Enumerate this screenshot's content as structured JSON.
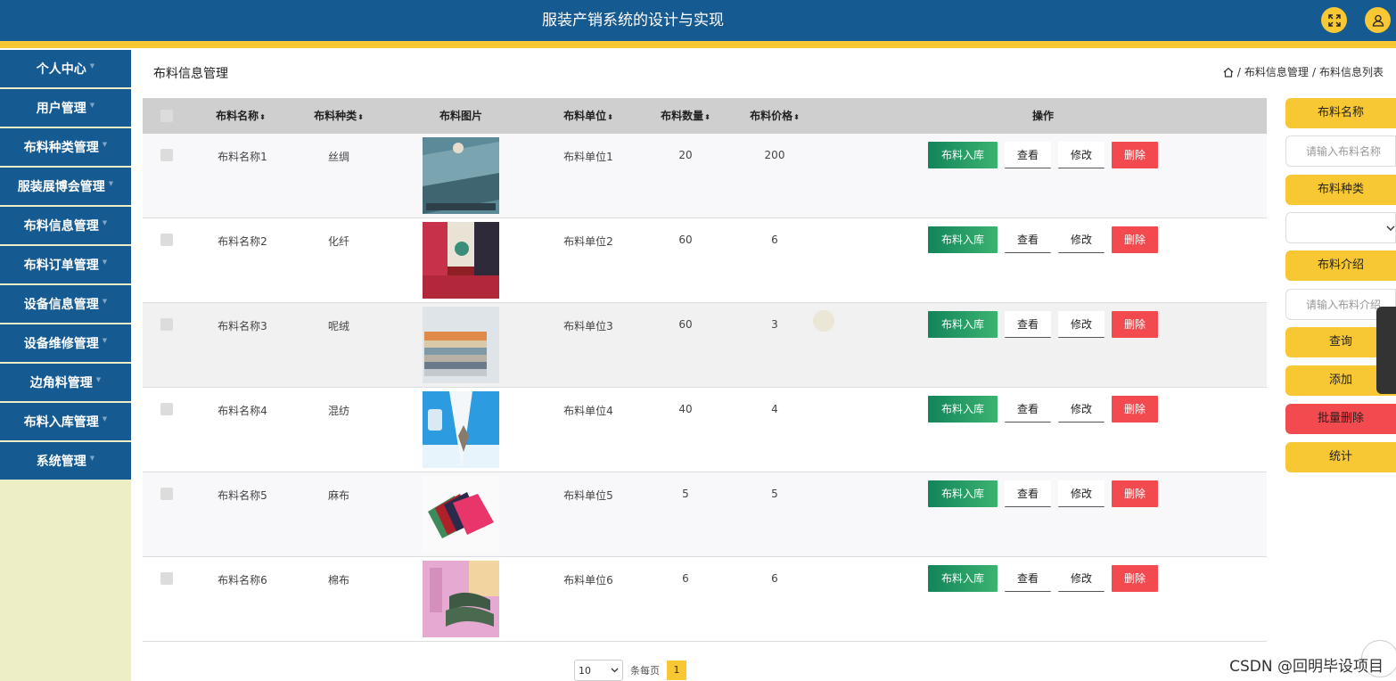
{
  "header": {
    "title": "服装产销系统的设计与实现"
  },
  "sidebar": {
    "items": [
      {
        "label": "个人中心"
      },
      {
        "label": "用户管理"
      },
      {
        "label": "布料种类管理"
      },
      {
        "label": "服装展博会管理"
      },
      {
        "label": "布料信息管理"
      },
      {
        "label": "布料订单管理"
      },
      {
        "label": "设备信息管理"
      },
      {
        "label": "设备维修管理"
      },
      {
        "label": "边角料管理"
      },
      {
        "label": "布料入库管理"
      },
      {
        "label": "系统管理"
      }
    ]
  },
  "page": {
    "title": "布料信息管理"
  },
  "breadcrumb": {
    "level1": "布料信息管理",
    "level2": "布料信息列表",
    "sep": "/"
  },
  "table": {
    "headers": {
      "name": "布料名称",
      "type": "布料种类",
      "image": "布料图片",
      "unit": "布料单位",
      "qty": "布料数量",
      "price": "布料价格",
      "ops": "操作"
    },
    "sort_glyph": "⬍",
    "rows": [
      {
        "name": "布料名称1",
        "type": "丝绸",
        "unit": "布料单位1",
        "qty": "20",
        "price": "200"
      },
      {
        "name": "布料名称2",
        "type": "化纤",
        "unit": "布料单位2",
        "qty": "60",
        "price": "6"
      },
      {
        "name": "布料名称3",
        "type": "呢绒",
        "unit": "布料单位3",
        "qty": "60",
        "price": "3"
      },
      {
        "name": "布料名称4",
        "type": "混纺",
        "unit": "布料单位4",
        "qty": "40",
        "price": "4"
      },
      {
        "name": "布料名称5",
        "type": "麻布",
        "unit": "布料单位5",
        "qty": "5",
        "price": "5"
      },
      {
        "name": "布料名称6",
        "type": "棉布",
        "unit": "布料单位6",
        "qty": "6",
        "price": "6"
      }
    ],
    "actions": {
      "stock": "布料入库",
      "view": "查看",
      "edit": "修改",
      "delete": "删除"
    }
  },
  "pagination": {
    "page_size": "10",
    "per_page_label": "条每页",
    "current_page": "1"
  },
  "search_panel": {
    "name_label": "布料名称",
    "name_placeholder": "请输入布料名称",
    "type_label": "布料种类",
    "intro_label": "布料介绍",
    "intro_placeholder": "请输入布料介绍",
    "query": "查询",
    "add": "添加",
    "batch_delete": "批量删除",
    "stats": "统计"
  },
  "watermark": "CSDN @回明毕设项目",
  "colors": {
    "primary": "#165a92",
    "accent": "#f7c833",
    "danger": "#f24a4e",
    "success": "#12845a"
  }
}
